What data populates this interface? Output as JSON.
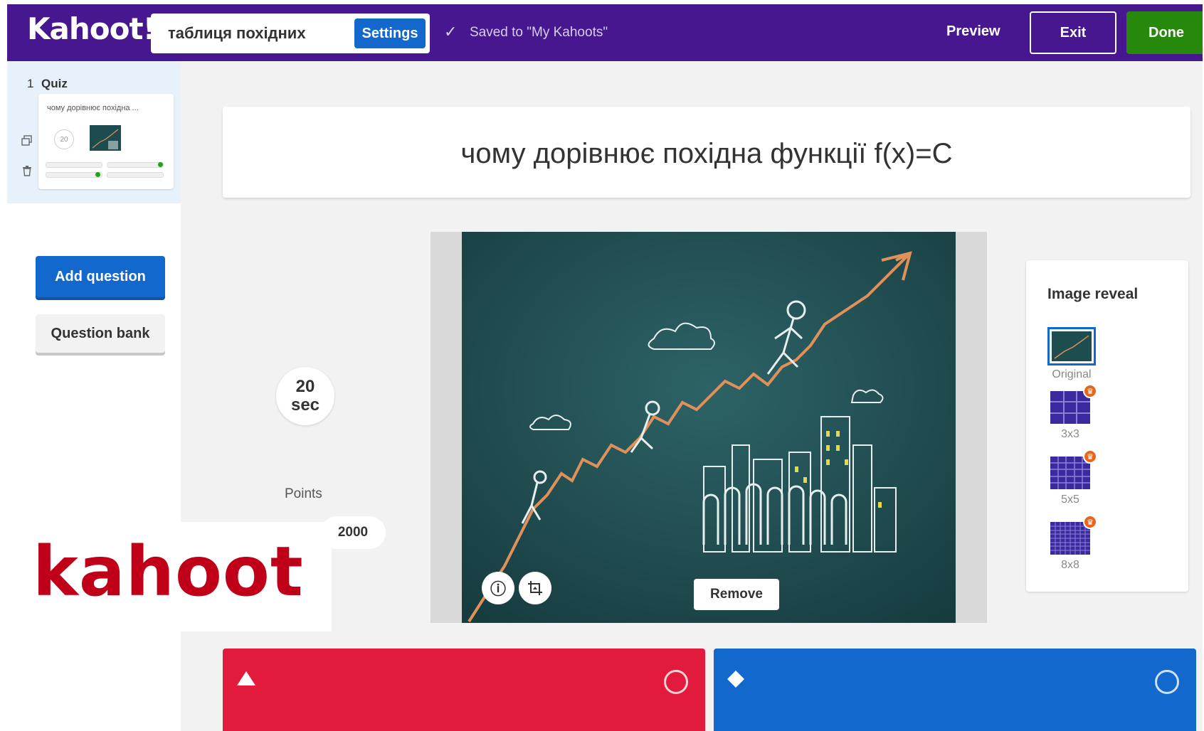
{
  "app": {
    "logo": "Kahoot!"
  },
  "header": {
    "kahoot_title": "таблиця похідних",
    "settings_label": "Settings",
    "saved_text": "Saved to \"My Kahoots\"",
    "preview_label": "Preview",
    "exit_label": "Exit",
    "done_label": "Done"
  },
  "sidebar": {
    "slide_number": "1",
    "slide_type": "Quiz",
    "slide_preview_title": "чому дорівнює похідна ...",
    "slide_preview_timer": "20",
    "add_question_label": "Add question",
    "question_bank_label": "Question bank"
  },
  "question": {
    "title": "чому дорівнює похідна функції f(x)=C",
    "timer_value": "20",
    "timer_unit": "sec",
    "points_label": "Points",
    "points_value": "2000",
    "remove_label": "Remove"
  },
  "image_reveal": {
    "title": "Image reveal",
    "options": [
      {
        "label": "Original",
        "icon": "original-thumbnail-icon"
      },
      {
        "label": "3x3",
        "icon": "grid-3x3-icon"
      },
      {
        "label": "5x5",
        "icon": "grid-5x5-icon"
      },
      {
        "label": "8x8",
        "icon": "grid-8x8-icon"
      }
    ]
  },
  "overlay": {
    "caption": "kahoot"
  },
  "colors": {
    "header": "#46178f",
    "accent_blue": "#1368ce",
    "done_green": "#26890c",
    "answer_red": "#e21b3c",
    "answer_blue": "#1368ce",
    "overlay_red": "#c00018"
  }
}
